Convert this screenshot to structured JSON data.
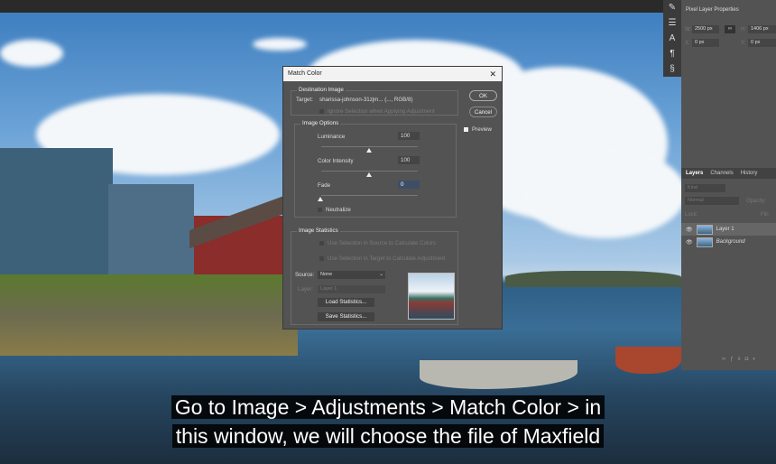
{
  "properties_panel": {
    "title": "Pixel Layer Properties",
    "w": "2500 px",
    "h": "1406 px",
    "x": "0 px",
    "y": "0 px",
    "w_label": "W:",
    "h_label": "H:",
    "x_label": "X:",
    "y_label": "Y:"
  },
  "layers_panel": {
    "tabs": [
      "Layers",
      "Channels",
      "History"
    ],
    "search_placeholder": "Kind",
    "blend_mode": "Normal",
    "opacity_label": "Opacity:",
    "lock_label": "Lock:",
    "fill_label": "Fill:",
    "layers": [
      {
        "name": "Layer 1",
        "visible": true
      },
      {
        "name": "Background",
        "visible": true
      }
    ]
  },
  "dialog": {
    "title": "Match Color",
    "close": "✕",
    "destination_label": "Destination Image",
    "target_label": "Target:",
    "target_value": "sharissa-johnson-31zjm... (..., RGB/8)",
    "ignore_selection": "Ignore Selection when Applying Adjustment",
    "image_options_label": "Image Options",
    "luminance_label": "Luminance",
    "luminance": "100",
    "color_intensity_label": "Color Intensity",
    "color_intensity": "100",
    "fade_label": "Fade",
    "fade": "0",
    "neutralize": "Neutralize",
    "ok": "OK",
    "cancel": "Cancel",
    "preview": "Preview",
    "statistics_label": "Image Statistics",
    "use_source": "Use Selection in Source to Calculate Colors",
    "use_target": "Use Selection in Target to Calculate Adjustment",
    "source_label": "Source:",
    "source_value": "None",
    "layer_label": "Layer:",
    "layer_value": "Layer 1",
    "load": "Load Statistics...",
    "save": "Save Statistics..."
  },
  "subtitle": {
    "line1": "Go to Image > Adjustments > Match Color > in",
    "line2": "this window, we will choose the file of Maxfield"
  }
}
